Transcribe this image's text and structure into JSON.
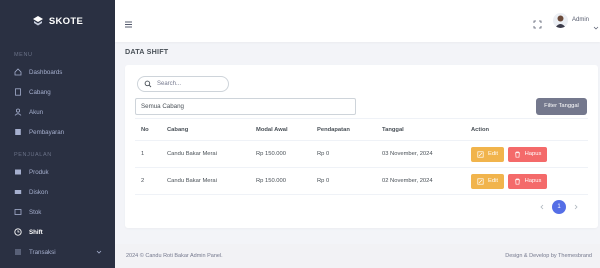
{
  "brand": {
    "name": "SKOTE",
    "logo_icon": "logo-icon"
  },
  "sidebar": {
    "menu_title": "MENU",
    "items": [
      {
        "label": "Dashboards",
        "icon": "home-icon"
      },
      {
        "label": "Cabang",
        "icon": "file-icon"
      },
      {
        "label": "Akun",
        "icon": "user-icon"
      },
      {
        "label": "Pembayaran",
        "icon": "receipt-icon"
      }
    ],
    "section_title": "PENJUALAN",
    "items2": [
      {
        "label": "Produk",
        "icon": "box-icon"
      },
      {
        "label": "Diskon",
        "icon": "ticket-icon"
      },
      {
        "label": "Stok",
        "icon": "stock-icon"
      },
      {
        "label": "Shift",
        "icon": "clock-icon",
        "active": true
      },
      {
        "label": "Transaksi",
        "icon": "list-icon"
      }
    ]
  },
  "topbar": {
    "user_name": "Admin"
  },
  "page": {
    "title": "DATA SHIFT"
  },
  "search": {
    "placeholder": "Search..."
  },
  "filter": {
    "branch_value": "Semua Cabang",
    "button_label": "Filter Tanggal"
  },
  "table": {
    "headers": [
      "No",
      "Cabang",
      "Modal Awal",
      "Pendapatan",
      "Tanggal",
      "Action"
    ],
    "rows": [
      {
        "no": "1",
        "cabang": "Candu Bakar Merai",
        "modal_awal": "Rp 150.000",
        "pendapatan": "Rp 0",
        "tanggal": "03 November, 2024"
      },
      {
        "no": "2",
        "cabang": "Candu Bakar Merai",
        "modal_awal": "Rp 150.000",
        "pendapatan": "Rp 0",
        "tanggal": "02 November, 2024"
      }
    ],
    "edit_label": "Edit",
    "delete_label": "Hapus"
  },
  "pagination": {
    "current_page": "1"
  },
  "footer": {
    "left": "2024 © Candu Roti Bakar Admin Panel.",
    "right": "Design & Develop by Themesbrand"
  },
  "colors": {
    "sidebar": "#2a3042",
    "primary": "#556ee6",
    "warning": "#f1b44c",
    "danger": "#f46a6a",
    "secondary": "#74788d"
  }
}
